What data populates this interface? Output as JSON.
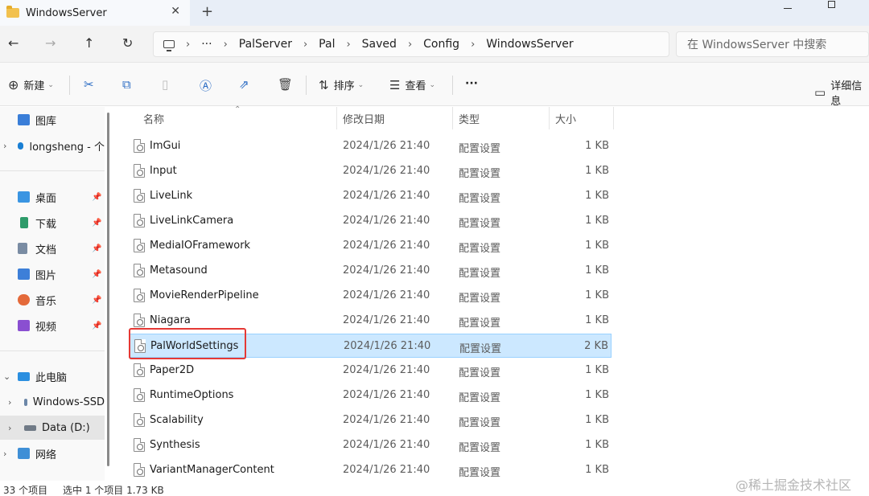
{
  "window": {
    "tab_title": "WindowsServer",
    "close_glyph": "✕",
    "new_tab_glyph": "+"
  },
  "nav": {
    "back_glyph": "←",
    "forward_glyph": "→",
    "up_glyph": "↑",
    "refresh_glyph": "↻",
    "more_glyph": "···",
    "sep_glyph": "›",
    "breadcrumbs": [
      "PalServer",
      "Pal",
      "Saved",
      "Config",
      "WindowsServer"
    ],
    "search_placeholder": "在 WindowsServer 中搜索"
  },
  "toolbar": {
    "new_label": "新建",
    "sort_label": "排序",
    "view_label": "查看",
    "more_glyph": "···",
    "details_label": "详细信息",
    "caret": "⌄"
  },
  "sidebar": {
    "gallery": "图库",
    "onedrive": "longsheng - 个",
    "quick": [
      {
        "label": "桌面",
        "color": "#3a95e2"
      },
      {
        "label": "下载",
        "color": "#2e9b6a"
      },
      {
        "label": "文档",
        "color": "#7a8ca3"
      },
      {
        "label": "图片",
        "color": "#3d7fd8"
      },
      {
        "label": "音乐",
        "color": "#e46a3a"
      },
      {
        "label": "视频",
        "color": "#8a4fd1"
      }
    ],
    "this_pc": "此电脑",
    "drive_c": "Windows-SSD",
    "drive_d": "Data (D:)",
    "network": "网络",
    "pin_glyph": "📌"
  },
  "columns": {
    "name": "名称",
    "date": "修改日期",
    "type": "类型",
    "size": "大小"
  },
  "files": [
    {
      "name": "ImGui",
      "date": "2024/1/26 21:40",
      "type": "配置设置",
      "size": "1 KB"
    },
    {
      "name": "Input",
      "date": "2024/1/26 21:40",
      "type": "配置设置",
      "size": "1 KB"
    },
    {
      "name": "LiveLink",
      "date": "2024/1/26 21:40",
      "type": "配置设置",
      "size": "1 KB"
    },
    {
      "name": "LiveLinkCamera",
      "date": "2024/1/26 21:40",
      "type": "配置设置",
      "size": "1 KB"
    },
    {
      "name": "MediaIOFramework",
      "date": "2024/1/26 21:40",
      "type": "配置设置",
      "size": "1 KB"
    },
    {
      "name": "Metasound",
      "date": "2024/1/26 21:40",
      "type": "配置设置",
      "size": "1 KB"
    },
    {
      "name": "MovieRenderPipeline",
      "date": "2024/1/26 21:40",
      "type": "配置设置",
      "size": "1 KB"
    },
    {
      "name": "Niagara",
      "date": "2024/1/26 21:40",
      "type": "配置设置",
      "size": "1 KB"
    },
    {
      "name": "PalWorldSettings",
      "date": "2024/1/26 21:40",
      "type": "配置设置",
      "size": "2 KB",
      "selected": true
    },
    {
      "name": "Paper2D",
      "date": "2024/1/26 21:40",
      "type": "配置设置",
      "size": "1 KB"
    },
    {
      "name": "RuntimeOptions",
      "date": "2024/1/26 21:40",
      "type": "配置设置",
      "size": "1 KB"
    },
    {
      "name": "Scalability",
      "date": "2024/1/26 21:40",
      "type": "配置设置",
      "size": "1 KB"
    },
    {
      "name": "Synthesis",
      "date": "2024/1/26 21:40",
      "type": "配置设置",
      "size": "1 KB"
    },
    {
      "name": "VariantManagerContent",
      "date": "2024/1/26 21:40",
      "type": "配置设置",
      "size": "1 KB"
    }
  ],
  "status": {
    "count": "33 个项目",
    "selection": "选中 1 个项目  1.73 KB"
  },
  "watermark": "@稀土掘金技术社区",
  "colors": {
    "selection_bg": "#cce8ff",
    "highlight": "#e53935",
    "accent": "#2b6cc4"
  }
}
